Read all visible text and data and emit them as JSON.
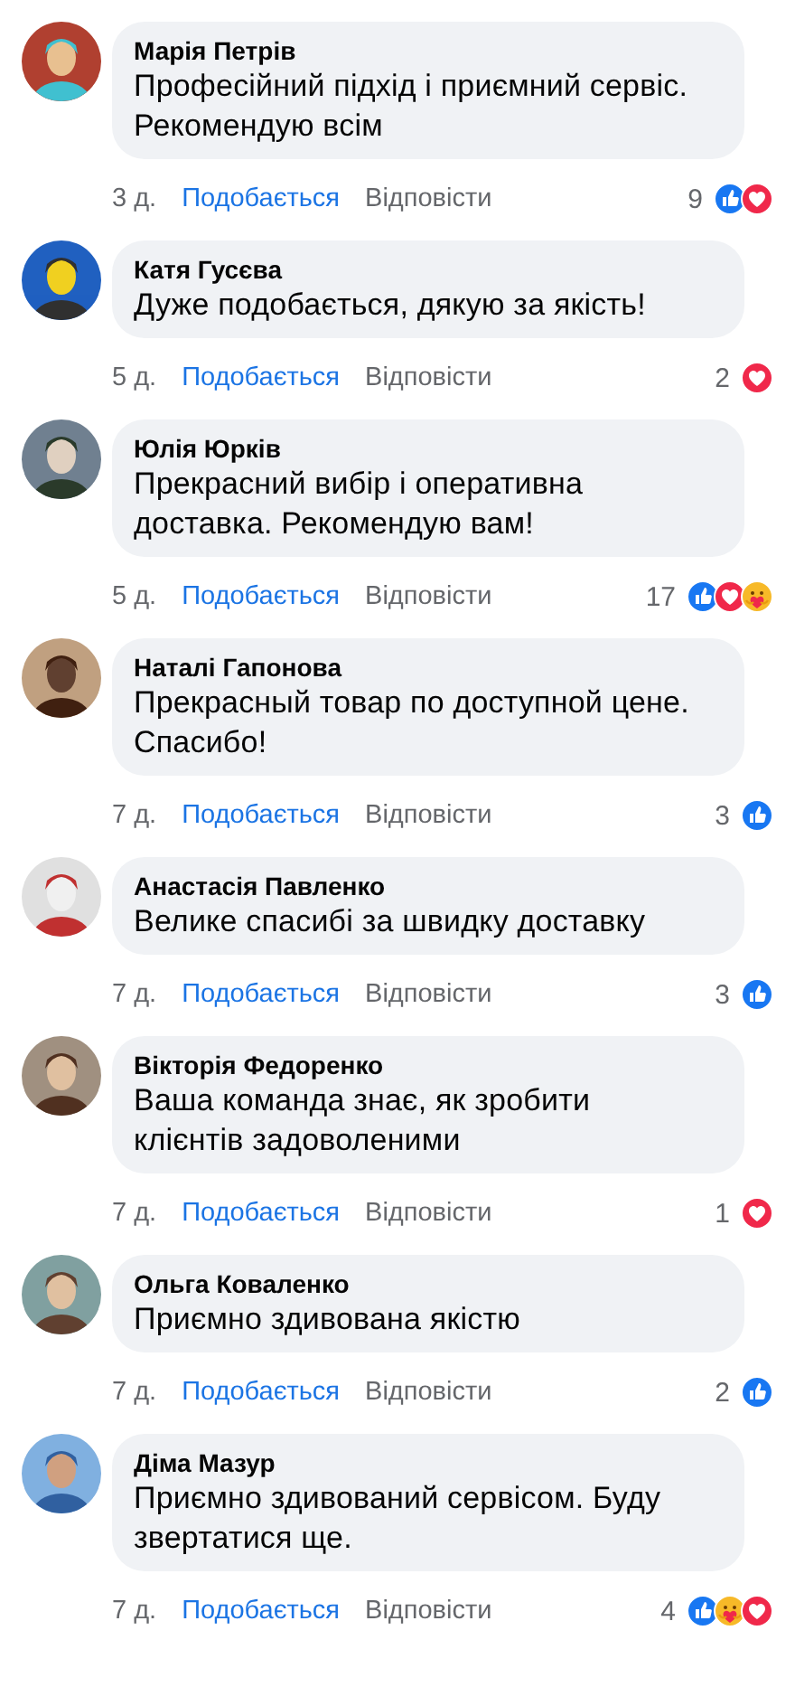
{
  "comments": [
    {
      "author": "Марія Петрів",
      "text": "Професійний підхід і приємний сервіс. Рекомендую всім",
      "time": "3 д.",
      "like_label": "Подобається",
      "reply_label": "Відповісти",
      "count": "9",
      "reactions": [
        {
          "kind": "like"
        },
        {
          "kind": "love"
        }
      ]
    },
    {
      "author": "Катя Гусєва",
      "text": "Дуже подобається, дякую за якість!",
      "time": "5 д.",
      "like_label": "Подобається",
      "reply_label": "Відповісти",
      "count": "2",
      "reactions": [
        {
          "kind": "love"
        }
      ]
    },
    {
      "author": "Юлія Юрків",
      "text": "Прекрасний вибір і оперативна доставка. Рекомендую вам!",
      "time": "5 д.",
      "like_label": "Подобається",
      "reply_label": "Відповісти",
      "count": "17",
      "reactions": [
        {
          "kind": "like"
        },
        {
          "kind": "love"
        },
        {
          "kind": "care"
        }
      ]
    },
    {
      "author": "Наталі Гапонова",
      "text": "Прекрасный товар по доступной цене. Спасибо!",
      "time": "7 д.",
      "like_label": "Подобається",
      "reply_label": "Відповісти",
      "count": "3",
      "reactions": [
        {
          "kind": "like"
        }
      ]
    },
    {
      "author": "Анастасія Павленко",
      "text": "Велике спасибі за швидку доставку",
      "time": "7 д.",
      "like_label": "Подобається",
      "reply_label": "Відповісти",
      "count": "3",
      "reactions": [
        {
          "kind": "like"
        }
      ]
    },
    {
      "author": "Вікторія Федоренко",
      "text": "Ваша команда знає, як зробити клієнтів задоволеними",
      "time": "7 д.",
      "like_label": "Подобається",
      "reply_label": "Відповісти",
      "count": "1",
      "reactions": [
        {
          "kind": "love"
        }
      ]
    },
    {
      "author": "Ольга Коваленко",
      "text": "Приємно здивована якістю",
      "time": "7 д.",
      "like_label": "Подобається",
      "reply_label": "Відповісти",
      "count": "2",
      "reactions": [
        {
          "kind": "like"
        }
      ]
    },
    {
      "author": "Діма Мазур",
      "text": "Приємно здивований сервісом. Буду звертатися ще.",
      "time": "7 д.",
      "like_label": "Подобається",
      "reply_label": "Відповісти",
      "count": "4",
      "reactions": [
        {
          "kind": "like"
        },
        {
          "kind": "care"
        },
        {
          "kind": "love"
        }
      ]
    }
  ]
}
